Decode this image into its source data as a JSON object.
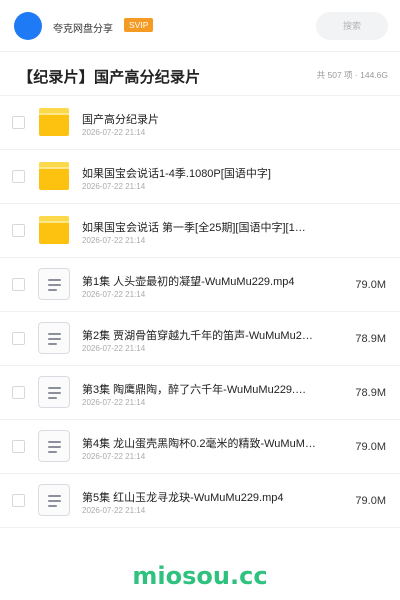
{
  "header": {
    "share_name": "夸克网盘分享",
    "badge": "SVIP",
    "search_placeholder": "搜索",
    "brand_color": "#1e7bf5",
    "badge_color": "#f59a23"
  },
  "page": {
    "title": "【纪录片】国产高分纪录片",
    "meta": "共 507 项 · 144.6G"
  },
  "files": [
    {
      "type": "folder",
      "icon": "folder-icon",
      "name": "国产高分纪录片",
      "date": "2026-07-22 21:14",
      "size": ""
    },
    {
      "type": "folder",
      "icon": "folder-icon",
      "name": "如果国宝会说话1-4季.1080P[国语中字]",
      "date": "2026-07-22 21:14",
      "size": ""
    },
    {
      "type": "folder",
      "icon": "folder-icon",
      "name": "如果国宝会说话 第一季[全25期][国语中字][1…",
      "date": "2026-07-22 21:14",
      "size": ""
    },
    {
      "type": "file",
      "icon": "document-icon",
      "name": "第1集 人头壶最初的凝望-WuMuMu229.mp4",
      "date": "2026-07-22 21:14",
      "size": "79.0M"
    },
    {
      "type": "file",
      "icon": "document-icon",
      "name": "第2集 贾湖骨笛穿越九千年的笛声-WuMuMu22…",
      "date": "2026-07-22 21:14",
      "size": "78.9M"
    },
    {
      "type": "file",
      "icon": "document-icon",
      "name": "第3集 陶鹰鼎陶，醉了六千年-WuMuMu229.…",
      "date": "2026-07-22 21:14",
      "size": "78.9M"
    },
    {
      "type": "file",
      "icon": "document-icon",
      "name": "第4集 龙山蛋壳黑陶杯0.2毫米的精致-WuMuM…",
      "date": "2026-07-22 21:14",
      "size": "79.0M"
    },
    {
      "type": "file",
      "icon": "document-icon",
      "name": "第5集 红山玉龙寻龙玦-WuMuMu229.mp4",
      "date": "2026-07-22 21:14",
      "size": "79.0M"
    }
  ],
  "watermark": "miosou.cc"
}
